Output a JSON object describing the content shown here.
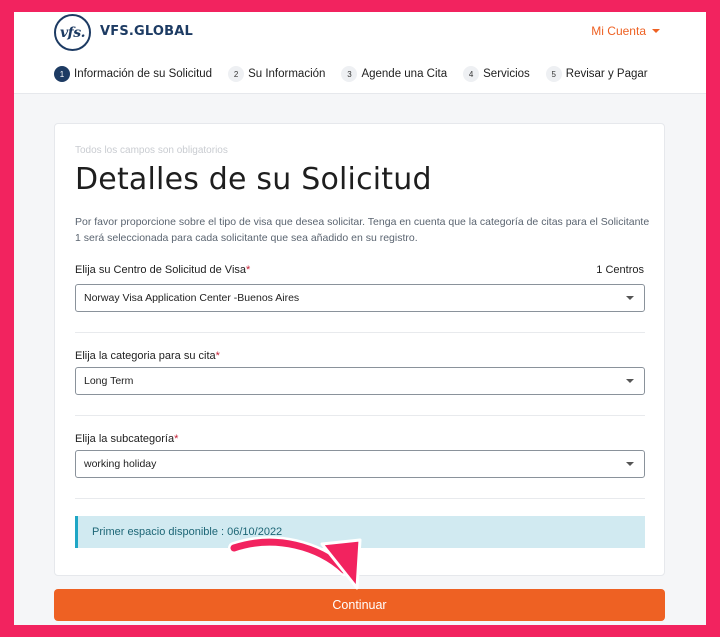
{
  "header": {
    "logo_mark": "vfs.",
    "logo_text": "VFS.GLOBAL",
    "account_label": "Mi Cuenta"
  },
  "steps": [
    {
      "num": "1",
      "label": "Información de su Solicitud",
      "active": true
    },
    {
      "num": "2",
      "label": "Su Información",
      "active": false
    },
    {
      "num": "3",
      "label": "Agende una Cita",
      "active": false
    },
    {
      "num": "4",
      "label": "Servicios",
      "active": false
    },
    {
      "num": "5",
      "label": "Revisar y Pagar",
      "active": false
    }
  ],
  "form": {
    "required_note": "Todos los campos son obligatorios",
    "title": "Detalles de su Solicitud",
    "description": "Por favor proporcione sobre el tipo de visa que desea solicitar. Tenga en cuenta que la categoría de citas para el Solicitante 1 será seleccionada para cada solicitante que sea añadido en su registro.",
    "center": {
      "label": "Elija su Centro de Solicitud de Visa",
      "required_mark": "*",
      "count": "1 Centros",
      "value": "Norway Visa Application Center -Buenos Aires"
    },
    "category": {
      "label": "Elija la categoria para su cita",
      "required_mark": "*",
      "value": "Long Term"
    },
    "subcategory": {
      "label": "Elija la subcategoría",
      "required_mark": "*",
      "value": "working holiday"
    },
    "availability": "Primer espacio disponible : 06/10/2022"
  },
  "continue_label": "Continuar",
  "colors": {
    "brand_navy": "#1d3b63",
    "accent_orange": "#ee6123",
    "border_pink": "#f2235f",
    "info_bg": "#d1eaf1"
  }
}
